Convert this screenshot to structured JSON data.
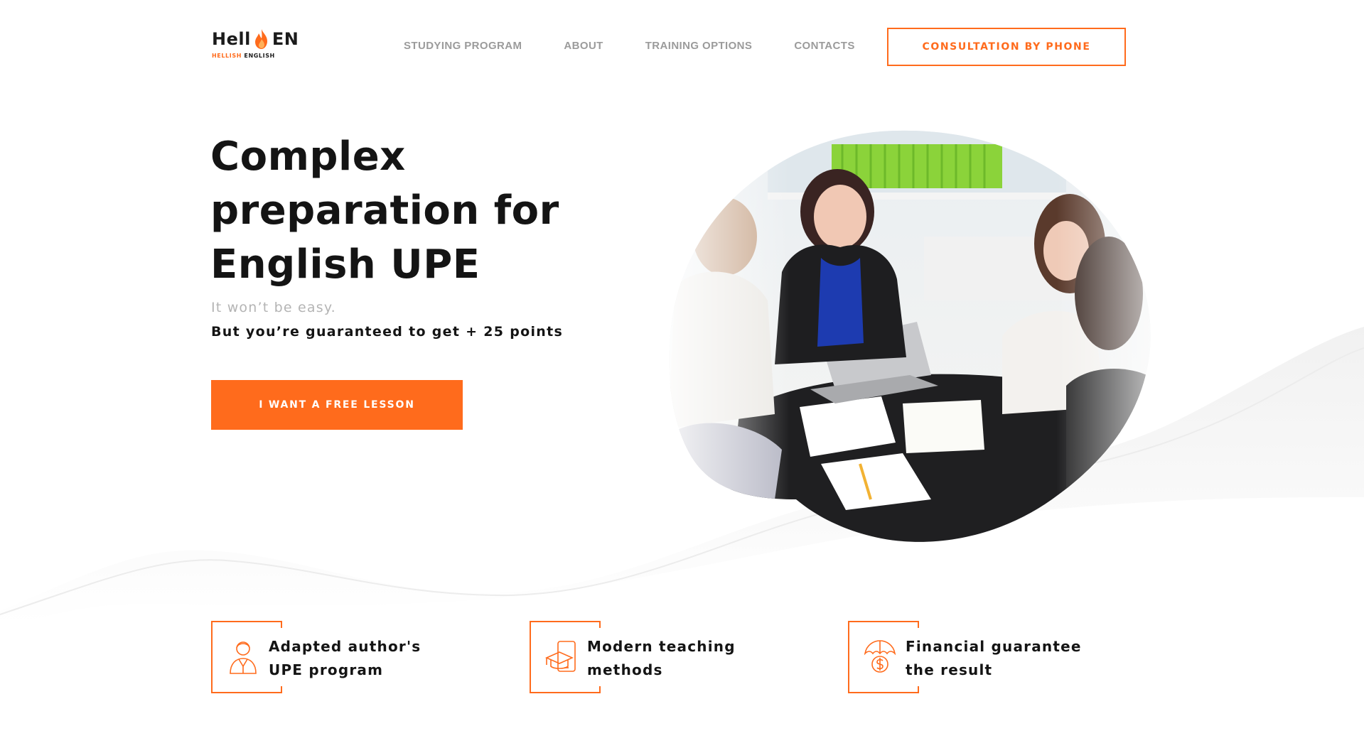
{
  "brand": {
    "logo_left": "Hell",
    "logo_right": "EN",
    "tagline_accent": "HELLISH",
    "tagline_rest": "ENGLISH",
    "accent_color": "#ff6b1c",
    "icon": "flame-icon"
  },
  "nav": {
    "items": [
      {
        "label": "STUDYING PROGRAM"
      },
      {
        "label": "ABOUT"
      },
      {
        "label": "TRAINING OPTIONS"
      },
      {
        "label": "CONTACTS"
      }
    ],
    "cta_label": "CONSULTATION BY PHONE"
  },
  "hero": {
    "title_line1": "Complex",
    "title_line2": "preparation for",
    "title_line3": "English UPE",
    "subtitle_muted": "It won’t be easy.",
    "subtitle_strong": "But you’re guaranteed to get + 25 points",
    "button_label": "I WANT A FREE LESSON",
    "image_semantic": "students-studying-photo"
  },
  "features": [
    {
      "line1": "Adapted author's",
      "line2": "UPE program",
      "icon": "teacher-icon"
    },
    {
      "line1": "Modern teaching",
      "line2": "methods",
      "icon": "graduation-tablet-icon"
    },
    {
      "line1": "Financial guarantee",
      "line2": "the result",
      "icon": "umbrella-money-icon"
    }
  ]
}
